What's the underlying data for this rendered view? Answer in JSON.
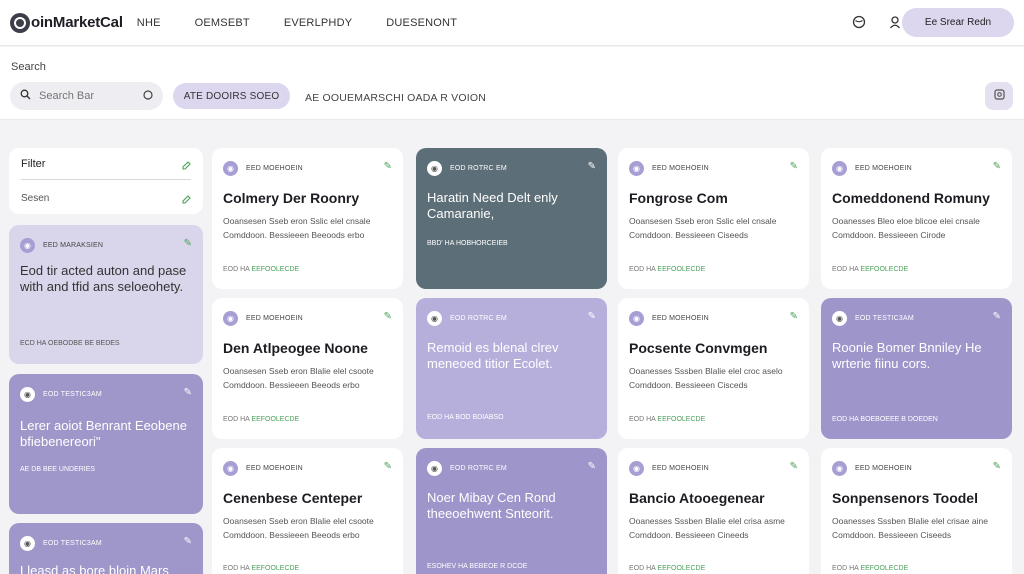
{
  "topbar": {
    "logo_text": "oinMarketCal",
    "nav": [
      "NHE",
      "OEMSEBT",
      "EVERLPHDY",
      "DUESENONT"
    ],
    "icons": [
      "globe-icon",
      "user-icon"
    ],
    "cta_label": "Ee Srear Redn"
  },
  "search": {
    "label": "Search",
    "placeholder": "Search Bar",
    "pill_label": "ATE DOOIRS SOEO",
    "breadcrumb": "AE OOUEMARSCHI OADA R VOION"
  },
  "sidebar": {
    "filter_title": "Filter",
    "filter_sub": "Sesen",
    "cards": [
      {
        "tag": "EED MARAKSIEN",
        "text": "Eod tir acted auton and pase with and tfid ans seloeohety.",
        "foot": "ECD HA   OEBODBE BE BEDES"
      },
      {
        "tag": "EOD TESTIC3AM",
        "text": "Lerer aoiot Benrant Eeobene bfiebenereori\"",
        "foot": "AE DB   BEE UNDERIES"
      },
      {
        "tag": "EOD TESTIC3AM",
        "text": "Lleasd as bore bloin Mars",
        "foot": ""
      }
    ]
  },
  "cards": [
    {
      "tag": "EED MOEHOEIN",
      "title": "Colmery Der Roonry",
      "desc": "Ooansesen Sseb eron Sslic elel cnsale Comddoon. Bessieeen Beeoods erbo",
      "foot_a": "EOD HA",
      "foot_b": "EEFOOLECDE"
    },
    {
      "tag": "EOD ROTRC EM",
      "title": "Haratin Need Delt enly Camaranie,",
      "desc": "",
      "foot_a": "BBD' HA   HOBHORCEIEB",
      "foot_b": ""
    },
    {
      "tag": "EED MOEHOEIN",
      "title": "Fongrose Com",
      "desc": "Ooansesen Sseb eron Sslic elel cnsale Comddoon. Bessieeen Ciseeds",
      "foot_a": "EOD HA",
      "foot_b": "EEFOOLECDE"
    },
    {
      "tag": "EED MOEHOEIN",
      "title": "Comeddonend Romuny",
      "desc": "Ooanesses Bleo eloe blicoe elei cnsale Comddoon. Bessieeen Cirode",
      "foot_a": "EOD HA",
      "foot_b": "EEFOOLECDE"
    },
    {
      "tag": "EED MOEHOEIN",
      "title": "Den Atlpeogee Noone",
      "desc": "Ooansesen Sseb eron Blalie elel csoote Comddoon. Bessieeen Beeods erbo",
      "foot_a": "EOD HA",
      "foot_b": "EEFOOLECDE"
    },
    {
      "tag": "EOD ROTRC EM",
      "title": "Remoid es blenal clrev meneoed titior Ecolet.",
      "desc": "",
      "foot_a": "EOD HA   BOD BDIABSO",
      "foot_b": ""
    },
    {
      "tag": "EED MOEHOEIN",
      "title": "Pocsente Convmgen",
      "desc": "Ooanesses Sssben Blalie elel croc aselo Comddoon. Bessieeen Cisceds",
      "foot_a": "EOD HA",
      "foot_b": "EEFOOLECDE"
    },
    {
      "tag": "EOD TESTIC3AM",
      "title": "Roonie Bomer Bnniley He wrterie fiinu cors.",
      "desc": "",
      "foot_a": "EOD HA   BOEBOEEE B DOEDEN",
      "foot_b": ""
    },
    {
      "tag": "EED MOEHOEIN",
      "title": "Cenenbese Centeper",
      "desc": "Ooansesen Sseb eron Blalie elel csoote Comddoon. Bessieeen Beeods erbo",
      "foot_a": "EOD HA",
      "foot_b": "EEFOOLECDE"
    },
    {
      "tag": "EOD ROTRC EM",
      "title": "Noer Mibay Cen Rond theeoehwent Snteorit.",
      "desc": "",
      "foot_a": "ESOHEV HA   BEBEOE R DCOE",
      "foot_b": ""
    },
    {
      "tag": "EED MOEHOEIN",
      "title": "Bancio Atooegenear",
      "desc": "Ooanesses Sssben Blalie elel crisa asme Comddoon. Bessieeen Cineeds",
      "foot_a": "EOD HA",
      "foot_b": "EEFOOLECDE"
    },
    {
      "tag": "EED MOEHOEIN",
      "title": "Sonpensenors Toodel",
      "desc": "Ooanesses Sssben Blalie elel crisae aine Comddoon. Bessieeen Ciseeds",
      "foot_a": "EOD HA",
      "foot_b": "EEFOOLECDE"
    }
  ],
  "colors": {
    "accent_lilac": "#dcd6ef",
    "card_slate": "#5c6e77",
    "card_lilac": "#b6afdc",
    "card_violet": "#9e95cb",
    "status_green": "#4aa05a"
  }
}
